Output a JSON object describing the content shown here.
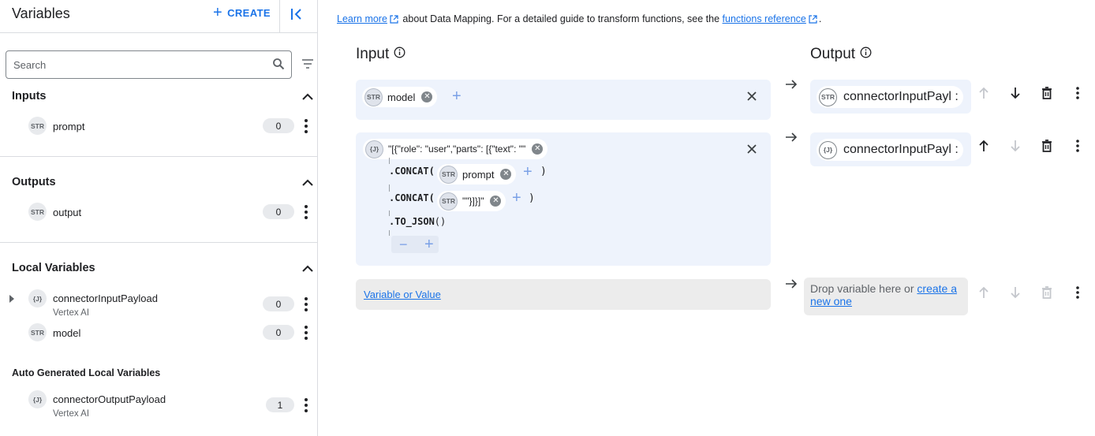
{
  "sidebar": {
    "title": "Variables",
    "create_label": "CREATE",
    "search_placeholder": "Search",
    "sections": {
      "inputs": {
        "title": "Inputs",
        "items": [
          {
            "type": "STR",
            "name": "prompt",
            "count": "0"
          }
        ]
      },
      "outputs": {
        "title": "Outputs",
        "items": [
          {
            "type": "STR",
            "name": "output",
            "count": "0"
          }
        ]
      },
      "local": {
        "title": "Local Variables",
        "items": [
          {
            "type": "{J}",
            "name": "connectorInputPayload",
            "sub": "Vertex AI",
            "count": "0"
          },
          {
            "type": "STR",
            "name": "model",
            "count": "0"
          }
        ]
      },
      "auto": {
        "title": "Auto Generated Local Variables",
        "items": [
          {
            "type": "{J}",
            "name": "connectorOutputPayload",
            "sub": "Vertex AI",
            "count": "1"
          }
        ]
      }
    }
  },
  "main": {
    "info": {
      "learn_more": "Learn more",
      "text": "about Data Mapping. For a detailed guide to transform functions, see the",
      "functions_ref": "functions reference",
      "end": "."
    },
    "input_title": "Input",
    "output_title": "Output",
    "rows": [
      {
        "input": {
          "type": "STR",
          "value": "model"
        },
        "output": {
          "type": "STR",
          "value": "connectorInputPayl :"
        }
      },
      {
        "input": {
          "type": "{J}",
          "value": "\"[{\"role\": \"user\",\"parts\": [{\"text\": \"\"",
          "fn1": ".CONCAT(",
          "fn1_arg": {
            "type": "STR",
            "value": "prompt"
          },
          "fn2": ".CONCAT(",
          "fn2_arg": {
            "type": "STR",
            "value": "\"\"}]}]\""
          },
          "fn3": ".TO_JSON",
          "fn3_parens": "()",
          "close_paren": ")"
        },
        "output": {
          "type": "{J}",
          "value": "connectorInputPayl :"
        }
      }
    ],
    "new_row": {
      "input_link": "Variable or Value",
      "drop_text": "Drop variable here or",
      "drop_link": "create a new one"
    }
  },
  "colors": {
    "accent": "#1a73e8",
    "card": "#eef3fc",
    "grey_card": "#ececec"
  }
}
